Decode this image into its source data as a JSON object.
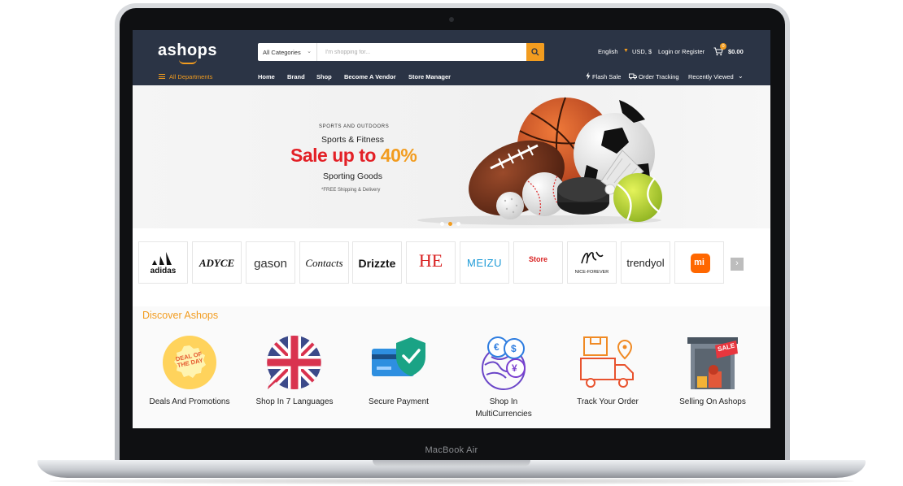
{
  "device": {
    "model_label": "MacBook Air"
  },
  "header": {
    "logo": "ashops",
    "search_category": "All Categories",
    "search_placeholder": "I'm shopping for...",
    "language": "English",
    "currency": "USD, $",
    "login": "Login or Register",
    "cart_count": "0",
    "cart_total": "$0.00"
  },
  "nav": {
    "all_departments": "All Departments",
    "items": [
      "Home",
      "Brand",
      "Shop",
      "Become A Vendor",
      "Store Manager"
    ],
    "flash_sale": "Flash Sale",
    "order_tracking": "Order Tracking",
    "recently_viewed": "Recently Viewed"
  },
  "hero": {
    "kicker": "SPORTS AND OUTDOORS",
    "subtitle": "Sports & Fitness",
    "sale": "Sale up to",
    "sale_pct": "40%",
    "goods": "Sporting Goods",
    "shipping": "*FREE Shipping & Delivery",
    "slide_count": 3,
    "active_slide": 2
  },
  "brands": [
    "adidas",
    "ADYCE",
    "gason",
    "Contacts",
    "Drizzte",
    "HE",
    "MEIZU",
    "Store",
    "NICE-FOREVER",
    "trendyol",
    "mi"
  ],
  "discover": {
    "title": "Discover Ashops",
    "features": [
      {
        "label": "Deals And Promotions",
        "badge": "DEAL OF THE DAY"
      },
      {
        "label": "Shop In 7 Languages"
      },
      {
        "label": "Secure Payment"
      },
      {
        "label": "Shop In MultiCurrencies"
      },
      {
        "label": "Track Your Order"
      },
      {
        "label": "Selling On Ashops",
        "badge": "SALE"
      }
    ]
  },
  "colors": {
    "accent": "#f29c1f",
    "header_bg": "#2b3445",
    "sale_red": "#e32026"
  }
}
